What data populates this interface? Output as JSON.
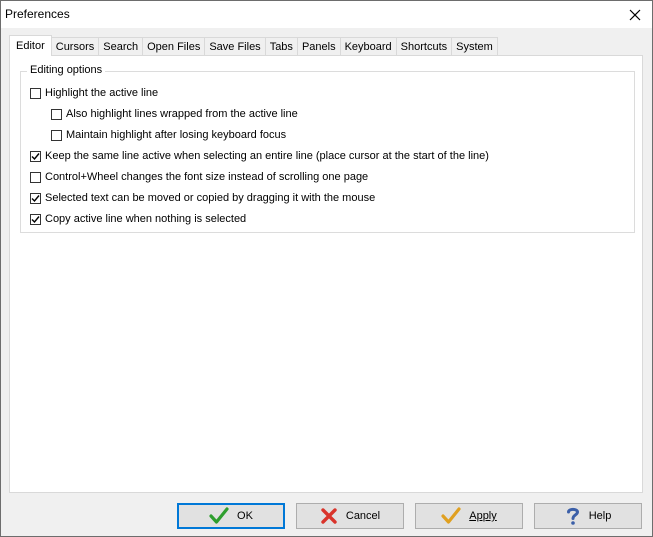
{
  "window": {
    "title": "Preferences"
  },
  "tabs": [
    {
      "label": "Editor",
      "active": true
    },
    {
      "label": "Cursors"
    },
    {
      "label": "Search"
    },
    {
      "label": "Open Files"
    },
    {
      "label": "Save Files"
    },
    {
      "label": "Tabs"
    },
    {
      "label": "Panels"
    },
    {
      "label": "Keyboard"
    },
    {
      "label": "Shortcuts"
    },
    {
      "label": "System"
    }
  ],
  "editing": {
    "group_title": "Editing options",
    "options": [
      {
        "label": "Highlight the active line",
        "checked": false
      },
      {
        "label": "Also highlight lines wrapped from the active line",
        "checked": false
      },
      {
        "label": "Maintain highlight after losing keyboard focus",
        "checked": false
      },
      {
        "label": "Keep the same line active when selecting an entire line (place cursor at the start of the line)",
        "checked": true
      },
      {
        "label": "Control+Wheel changes the font size instead of scrolling one page",
        "checked": false
      },
      {
        "label": "Selected text can be moved or copied by dragging it with the mouse",
        "checked": true
      },
      {
        "label": "Copy active line when nothing is selected",
        "checked": true
      }
    ]
  },
  "buttons": {
    "ok": "OK",
    "cancel": "Cancel",
    "apply": "Apply",
    "help": "Help"
  },
  "colors": {
    "ok_icon": "#2e9e2e",
    "cancel_icon": "#d9342b",
    "apply_icon": "#e0a020",
    "help_icon": "#3b5fa8",
    "focus_border": "#0078d7"
  }
}
